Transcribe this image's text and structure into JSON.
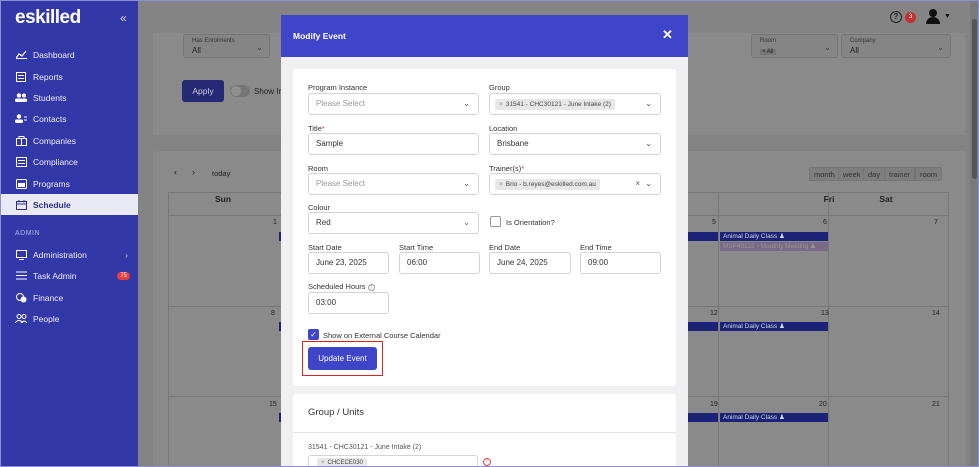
{
  "sidebar": {
    "logo": "eskilled",
    "items": [
      {
        "label": "Dashboard"
      },
      {
        "label": "Reports"
      },
      {
        "label": "Students"
      },
      {
        "label": "Contacts"
      },
      {
        "label": "Companies"
      },
      {
        "label": "Compliance"
      },
      {
        "label": "Programs"
      },
      {
        "label": "Schedule"
      }
    ],
    "admin_heading": "ADMIN",
    "admin_items": [
      {
        "label": "Administration"
      },
      {
        "label": "Task Admin",
        "badge": "75"
      },
      {
        "label": "Finance"
      },
      {
        "label": "People"
      }
    ]
  },
  "topbar": {
    "notifications": "3"
  },
  "filters": {
    "enrolments_label": "Has Enrolments",
    "enrolments_value": "All",
    "room_label": "Room",
    "room_value": "All",
    "company_label": "Company",
    "company_value": "All",
    "apply_label": "Apply",
    "show_label": "Show Inc"
  },
  "calendar": {
    "today_label": "today",
    "views": [
      "month",
      "week",
      "day",
      "trainer",
      "room"
    ],
    "days": [
      "Sun",
      "Sat",
      "Fri"
    ],
    "dates": {
      "r1": [
        "1",
        "5",
        "6",
        "7"
      ],
      "r2": [
        "8",
        "12",
        "13",
        "14"
      ],
      "r3": [
        "15",
        "19",
        "20",
        "21"
      ]
    },
    "events": {
      "animal": "Animal Daily Class",
      "meeting": "MSF40122 - Monthly Meeting"
    }
  },
  "modal": {
    "title": "Modify Event",
    "close": "✕",
    "program_instance_label": "Program Instance",
    "program_instance_placeholder": "Please Select",
    "group_label": "Group",
    "group_value": "31541 - CHC30121 - June Intake (2)",
    "title_label": "Title",
    "title_value": "Sample",
    "location_label": "Location",
    "location_value": "Brisbane",
    "room_label": "Room",
    "room_placeholder": "Please Select",
    "trainers_label": "Trainer(s)",
    "trainer_value": "Brio - b.reyes@eskilled.com.au",
    "colour_label": "Colour",
    "colour_value": "Red",
    "orientation_label": "Is Orientation?",
    "start_date_label": "Start Date",
    "start_date_value": "June 23, 2025",
    "start_time_label": "Start Time",
    "start_time_value": "06:00",
    "end_date_label": "End Date",
    "end_date_value": "June 24, 2025",
    "end_time_label": "End Time",
    "end_time_value": "09:00",
    "scheduled_hours_label": "Scheduled Hours",
    "scheduled_hours_value": "03:00",
    "external_calendar_label": "Show on External Course Calendar",
    "update_label": "Update Event",
    "group_units_title": "Group / Units",
    "group_units_item": "31541 - CHC30121 - June Intake (2)",
    "unit_chip": "CHCECE030"
  }
}
